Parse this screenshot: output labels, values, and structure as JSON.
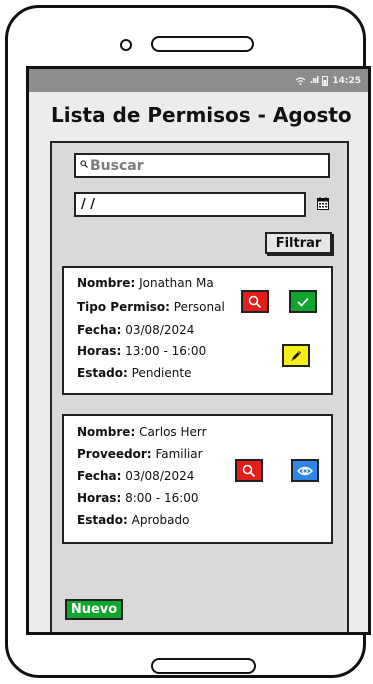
{
  "status_bar": {
    "time": "14:25",
    "signal": ".ııl",
    "wifi_icon": "wifi-icon",
    "battery_icon": "battery-icon"
  },
  "header": {
    "title": "Lista de Permisos - Agosto"
  },
  "search": {
    "placeholder": "Buscar"
  },
  "date_filter": {
    "value": "/ /"
  },
  "filter_button": {
    "label": "Filtrar"
  },
  "cards": [
    {
      "rows": [
        {
          "label": "Nombre:",
          "value": "Jonathan Ma"
        },
        {
          "label": "Tipo Permiso:",
          "value": "Personal"
        },
        {
          "label": "Fecha:",
          "value": "03/08/2024"
        },
        {
          "label": "Horas:",
          "value": "13:00 - 16:00"
        },
        {
          "label": "Estado:",
          "value": "Pendiente"
        }
      ],
      "actions": [
        "search-icon",
        "check-icon",
        "pencil-icon"
      ]
    },
    {
      "rows": [
        {
          "label": "Nombre:",
          "value": "Carlos Herr"
        },
        {
          "label": "Proveedor:",
          "value": "Familiar"
        },
        {
          "label": "Fecha:",
          "value": "03/08/2024"
        },
        {
          "label": "Horas:",
          "value": "8:00 - 16:00"
        },
        {
          "label": "Estado:",
          "value": "Aprobado"
        }
      ],
      "actions": [
        "search-icon",
        "eye-icon"
      ]
    }
  ],
  "new_button": {
    "label": "Nuevo"
  },
  "colors": {
    "danger": "#e31c1c",
    "success": "#10a52e",
    "warning": "#f7ef1a",
    "info": "#2f86e6",
    "panel": "#d9d9d9",
    "status_bar": "#8c8c8c"
  }
}
